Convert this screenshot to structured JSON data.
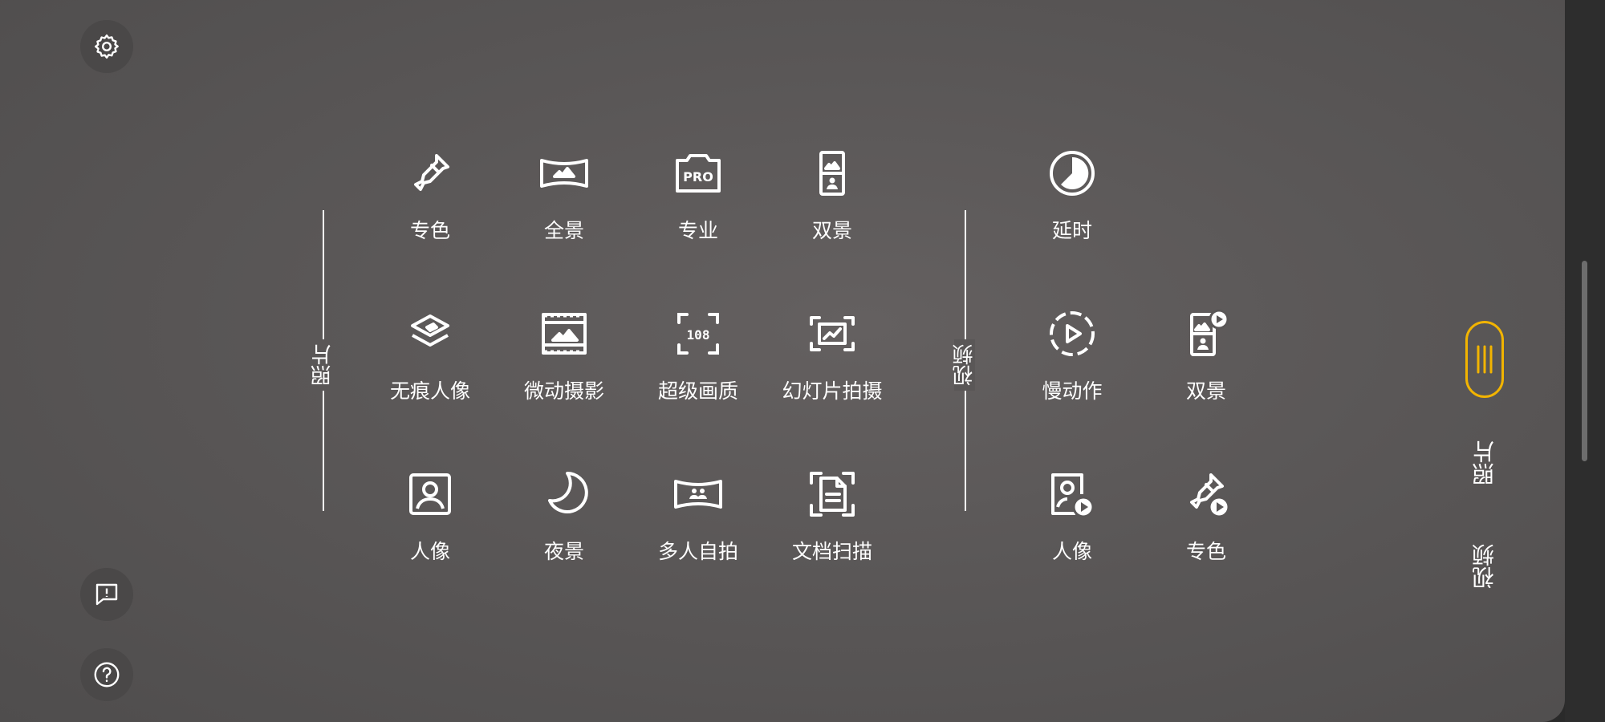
{
  "sections": {
    "photo_label": "照片",
    "video_label": "视频"
  },
  "photo_modes": [
    {
      "label": "专色",
      "icon": "eyedropper-icon"
    },
    {
      "label": "全景",
      "icon": "panorama-icon"
    },
    {
      "label": "专业",
      "icon": "pro-camera-icon"
    },
    {
      "label": "双景",
      "icon": "dual-view-icon"
    },
    {
      "label": "无痕人像",
      "icon": "layers-eraser-icon"
    },
    {
      "label": "微动摄影",
      "icon": "film-strip-icon"
    },
    {
      "label": "超级画质",
      "icon": "108-focus-icon"
    },
    {
      "label": "幻灯片拍摄",
      "icon": "slide-capture-icon"
    },
    {
      "label": "人像",
      "icon": "portrait-icon"
    },
    {
      "label": "夜景",
      "icon": "moon-icon"
    },
    {
      "label": "多人自拍",
      "icon": "group-selfie-icon"
    },
    {
      "label": "文档扫描",
      "icon": "document-scan-icon"
    }
  ],
  "video_modes": [
    {
      "label": "延时",
      "icon": "timelapse-icon"
    },
    {
      "label": "慢动作",
      "icon": "slow-motion-icon"
    },
    {
      "label": "双景",
      "icon": "dual-view-video-icon"
    },
    {
      "label": "人像",
      "icon": "portrait-video-icon"
    },
    {
      "label": "专色",
      "icon": "eyedropper-video-icon"
    }
  ],
  "mode_tabs": {
    "photo": "照片",
    "video": "视频"
  },
  "colors": {
    "accent": "#f2b400",
    "panel": "#5a5757"
  }
}
